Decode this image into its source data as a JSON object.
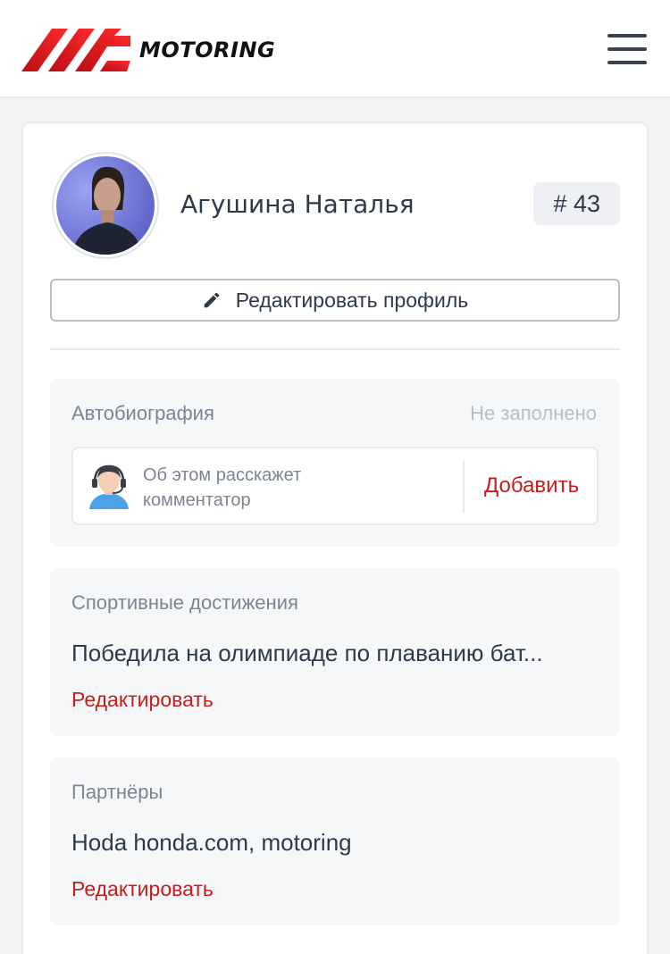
{
  "header": {
    "logo_text": "MOTORING",
    "brand_color": "#e3151b",
    "icons": {
      "logo": "motoring-logo-stripes",
      "menu": "hamburger-menu-icon"
    }
  },
  "profile": {
    "name": "Агушина Наталья",
    "number": "# 43",
    "edit_profile_label": "Редактировать профиль",
    "icons": {
      "edit": "pencil-icon",
      "avatar": "user-photo"
    }
  },
  "sections": {
    "autobiography": {
      "title": "Автобиография",
      "status": "Не заполнено",
      "placeholder": "Об этом расскажет комментатор",
      "add_label": "Добавить",
      "icon": "commentator-headset-icon"
    },
    "achievements": {
      "title": "Спортивные достижения",
      "value": "Победила на олимпиаде по плаванию бат...",
      "edit_label": "Редактировать"
    },
    "partners": {
      "title": "Партнёры",
      "value": "Hoda honda.com, motoring",
      "edit_label": "Редактировать"
    }
  },
  "colors": {
    "accent": "#c81d1d",
    "muted_text": "#7c8593",
    "primary_text": "#2d3a4a",
    "section_bg": "#f6f7f9"
  }
}
